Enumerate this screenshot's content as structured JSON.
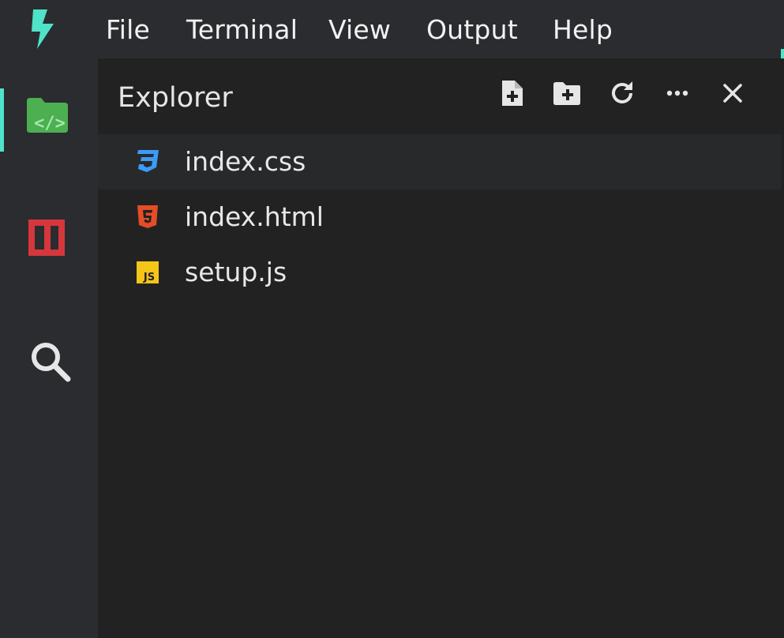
{
  "app": {
    "logo_icon": "lightning-bolt-icon",
    "accent_color": "#4fe3c9"
  },
  "menu": {
    "items": [
      {
        "label": "File"
      },
      {
        "label": "Terminal"
      },
      {
        "label": "View"
      },
      {
        "label": "Output"
      },
      {
        "label": "Help"
      }
    ]
  },
  "activitybar": {
    "items": [
      {
        "icon": "code-folder-icon",
        "color": "#4caf50",
        "active": true
      },
      {
        "icon": "npm-icon",
        "color": "#d5373d",
        "active": false
      },
      {
        "icon": "search-icon",
        "color": "#e0e0e0",
        "active": false
      }
    ]
  },
  "explorer": {
    "title": "Explorer",
    "toolbar": [
      {
        "icon": "new-file-icon"
      },
      {
        "icon": "new-folder-icon"
      },
      {
        "icon": "refresh-icon"
      },
      {
        "icon": "more-icon"
      },
      {
        "icon": "close-icon"
      }
    ],
    "files": [
      {
        "name": "index.css",
        "icon": "css3-icon",
        "color": "#3d9af7",
        "selected": true
      },
      {
        "name": "index.html",
        "icon": "html5-icon",
        "color": "#e44d26",
        "selected": false
      },
      {
        "name": "setup.js",
        "icon": "js-icon",
        "color": "#f5c518",
        "selected": false
      }
    ]
  }
}
